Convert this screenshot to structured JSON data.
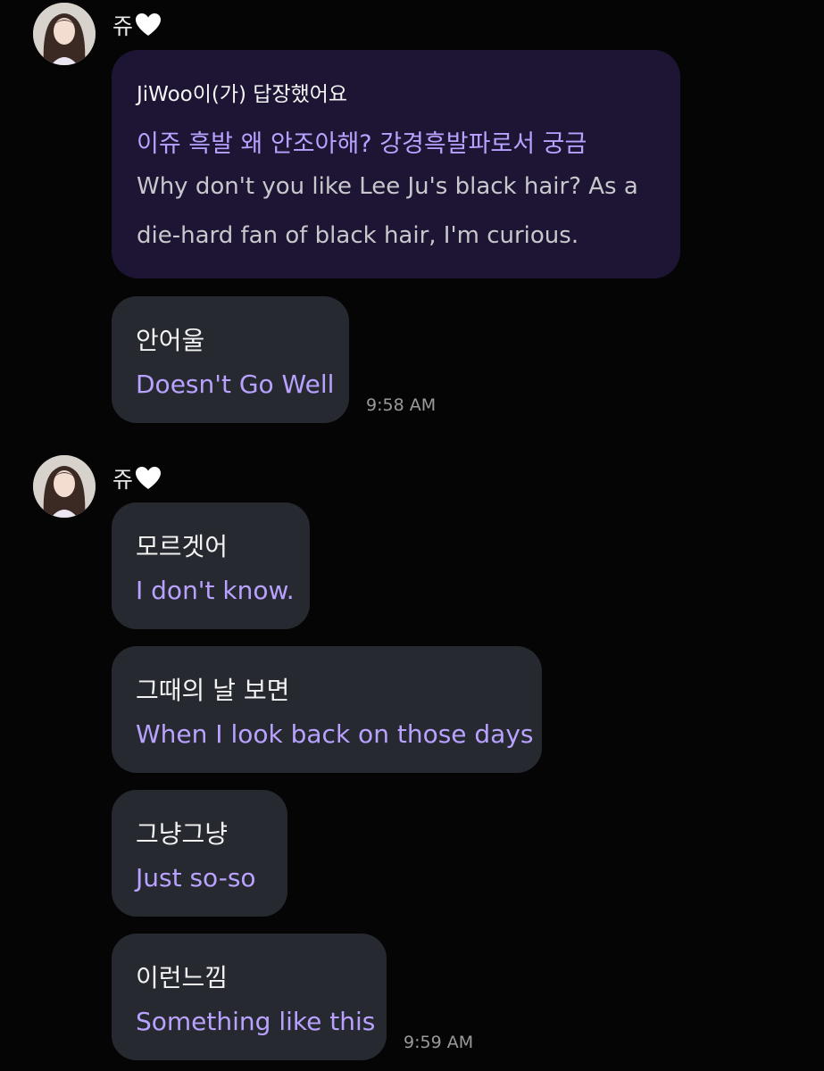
{
  "messages": {
    "group1": {
      "sender_name": "쥬",
      "sender_icon": "white-heart-icon",
      "reply": {
        "header": "JiWoo이(가) 답장했어요",
        "original_korean": "이쥬 흑발 왜 안조아해? 강경흑발파로서 궁금",
        "translation_line1": "Why don't you like Lee Ju's black hair? As a",
        "translation_line2": "die-hard fan of black hair, I'm curious."
      },
      "bubble1": {
        "korean": "안어울",
        "english": "Doesn't Go Well",
        "time": "9:58 AM"
      }
    },
    "group2": {
      "sender_name": "쥬",
      "sender_icon": "white-heart-icon",
      "bubble1": {
        "korean": "모르겟어",
        "english": "I don't know."
      },
      "bubble2": {
        "korean": "그때의 날 보면",
        "english": "When I look back on those days"
      },
      "bubble3": {
        "korean": "그냥그냥",
        "english": "Just so-so"
      },
      "bubble4": {
        "korean": "이런느낌",
        "english": "Something like this",
        "time": "9:59 AM"
      }
    }
  },
  "colors": {
    "background": "#050505",
    "bubble": "#262a30",
    "reply_bubble": "#1e1433",
    "translation_text": "#b9a2ff",
    "timestamp": "#9a9a9a"
  }
}
